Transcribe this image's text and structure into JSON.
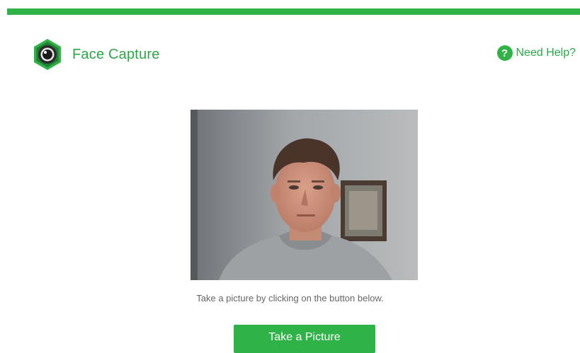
{
  "header": {
    "title": "Face Capture",
    "logo_icon": "camera-lens-icon",
    "help_label": "Need Help?",
    "help_icon_glyph": "?"
  },
  "camera": {
    "preview_icon": "webcam-preview"
  },
  "main": {
    "instruction": "Take a picture by clicking on the button below.",
    "button_label": "Take a Picture"
  },
  "colors": {
    "accent": "#2fb347",
    "text_green": "#2aa845",
    "muted_text": "#666666"
  }
}
